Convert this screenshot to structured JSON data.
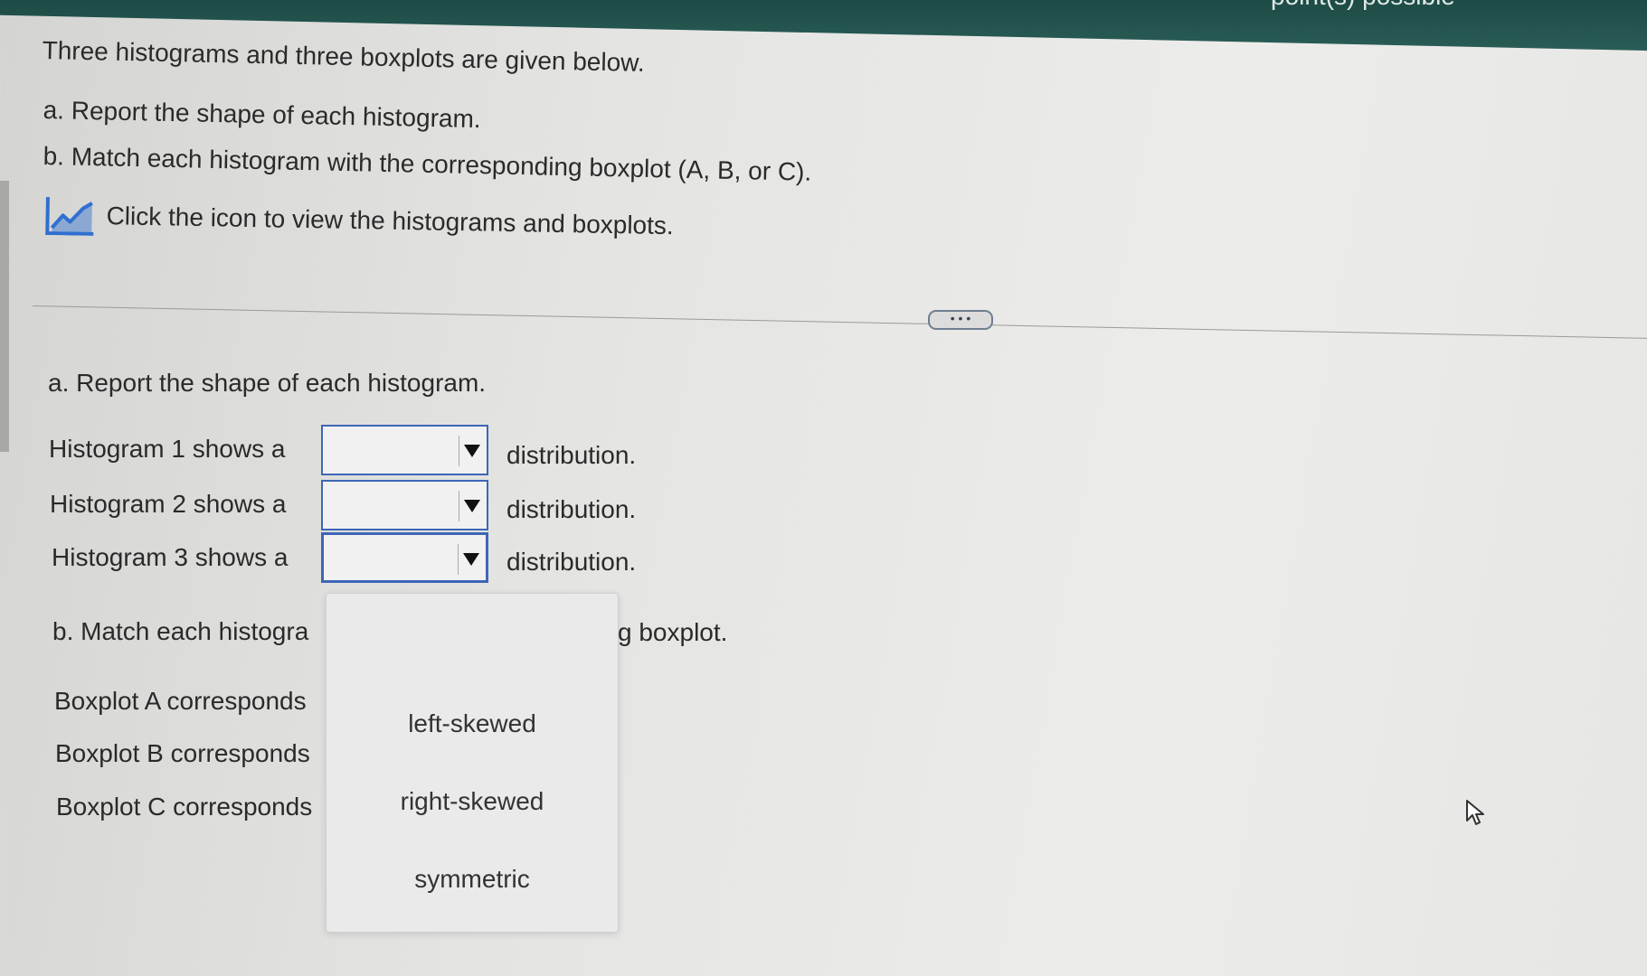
{
  "header": {
    "points_text": "point(s) possible"
  },
  "question": {
    "intro": "Three histograms and three boxplots are given below.",
    "part_a": "a. Report the shape of each histogram.",
    "part_b": "b. Match each histogram with the corresponding boxplot (A, B, or C).",
    "icon_text": "Click the icon to view the histograms and boxplots.",
    "icon": "line-chart-icon"
  },
  "more_button": "• • •",
  "section_a": {
    "title": "a. Report the shape of each histogram.",
    "rows": [
      {
        "label": "Histogram 1 shows a",
        "value": "",
        "suffix": "distribution."
      },
      {
        "label": "Histogram 2 shows a",
        "value": "",
        "suffix": "distribution."
      },
      {
        "label": "Histogram 3 shows a",
        "value": "",
        "suffix": "distribution."
      }
    ]
  },
  "section_b": {
    "title_left": "b. Match each histogra",
    "title_right": "g boxplot.",
    "rows": [
      "Boxplot A corresponds",
      "Boxplot B corresponds",
      "Boxplot C corresponds"
    ]
  },
  "dropdown_options": [
    "left-skewed",
    "right-skewed",
    "symmetric"
  ],
  "colors": {
    "header": "#1d4b45",
    "select_border": "#3d66b6",
    "icon_blue": "#2f6fd0"
  }
}
